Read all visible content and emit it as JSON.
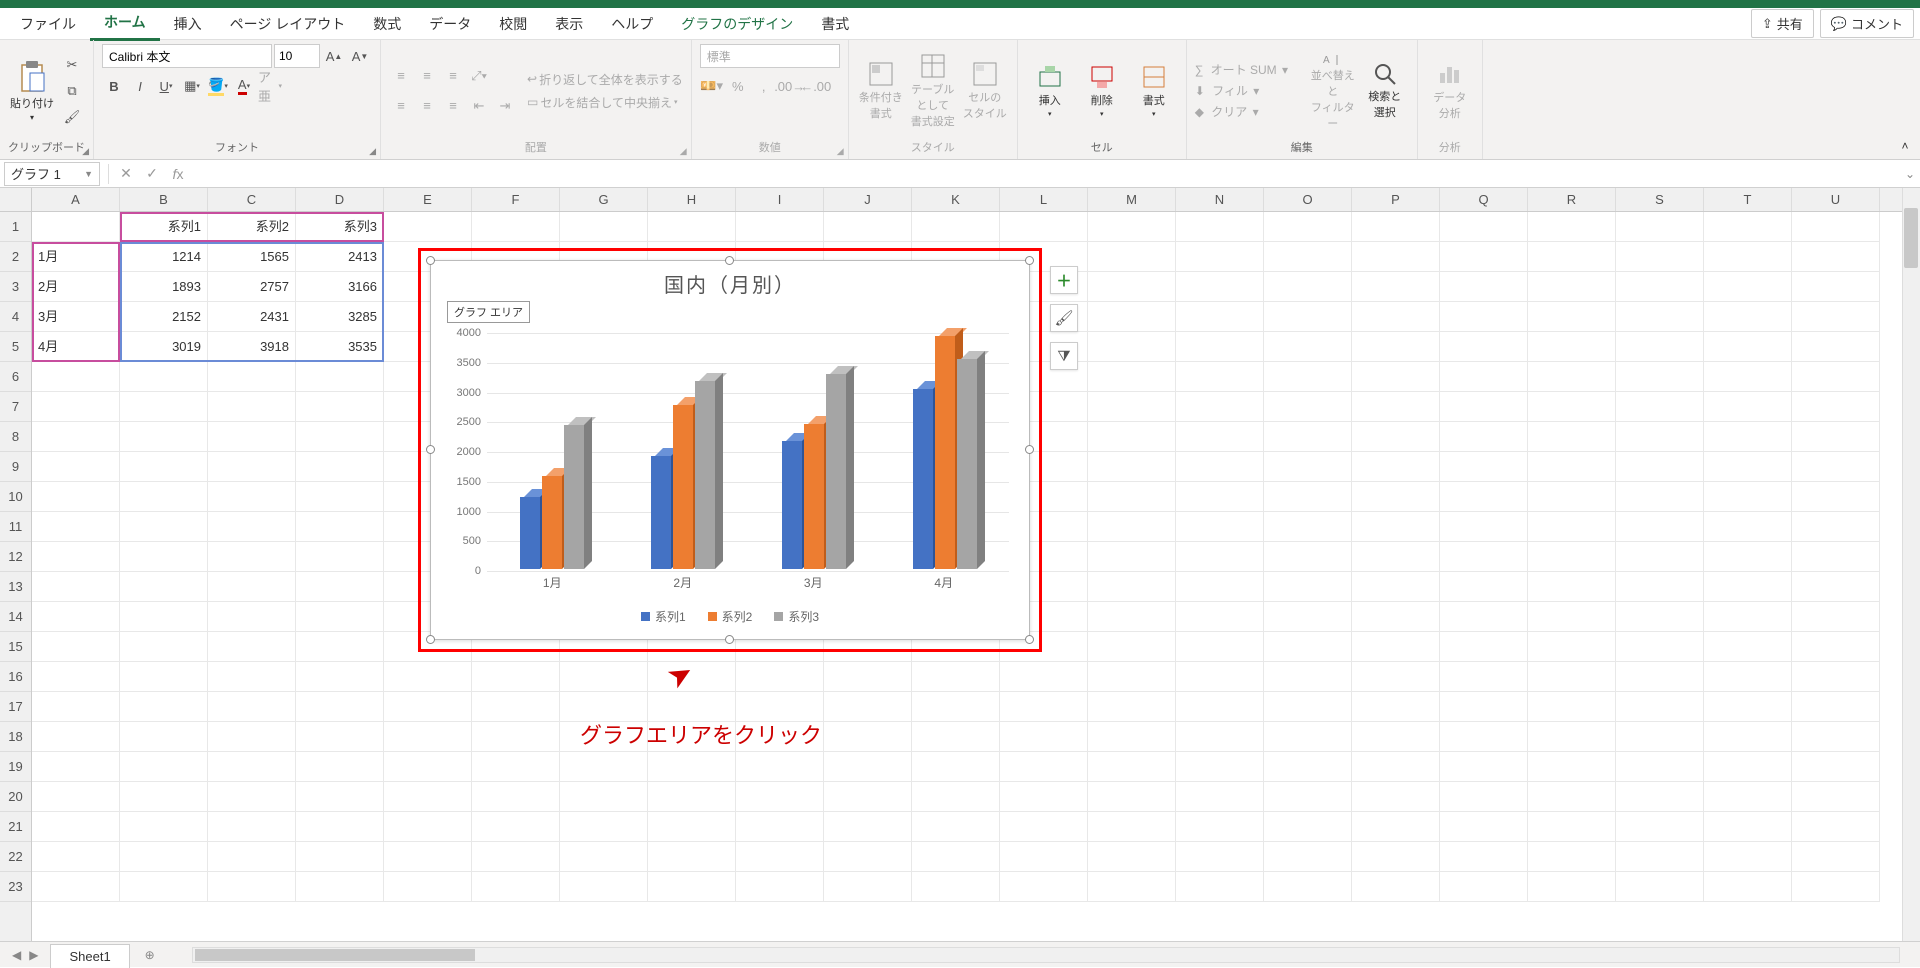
{
  "menu": {
    "tabs": [
      "ファイル",
      "ホーム",
      "挿入",
      "ページ レイアウト",
      "数式",
      "データ",
      "校閲",
      "表示",
      "ヘルプ",
      "グラフのデザイン",
      "書式"
    ],
    "active_index": 1,
    "share": "共有",
    "comment": "コメント"
  },
  "ribbon": {
    "clipboard": {
      "paste": "貼り付け",
      "group": "クリップボード"
    },
    "font": {
      "name": "Calibri 本文",
      "size": "10",
      "group": "フォント"
    },
    "alignment": {
      "wrap": "折り返して全体を表示する",
      "merge": "セルを結合して中央揃え",
      "group": "配置"
    },
    "number": {
      "format": "標準",
      "group": "数値"
    },
    "styles": {
      "cond": "条件付き\n書式",
      "table": "テーブルとして\n書式設定",
      "cell": "セルの\nスタイル",
      "group": "スタイル"
    },
    "cells": {
      "insert": "挿入",
      "delete": "削除",
      "format": "書式",
      "group": "セル"
    },
    "editing": {
      "autosum": "オート SUM",
      "fill": "フィル",
      "clear": "クリア",
      "sort": "並べ替えと\nフィルター",
      "find": "検索と\n選択",
      "group": "編集"
    },
    "analysis": {
      "label": "データ\n分析",
      "group": "分析"
    }
  },
  "namebox": "グラフ 1",
  "columns": [
    "A",
    "B",
    "C",
    "D",
    "E",
    "F",
    "G",
    "H",
    "I",
    "J",
    "K",
    "L",
    "M",
    "N",
    "O",
    "P",
    "Q",
    "R",
    "S",
    "T",
    "U"
  ],
  "rows": [
    "1",
    "2",
    "3",
    "4",
    "5",
    "6",
    "7",
    "8",
    "9",
    "10",
    "11",
    "12",
    "13",
    "14",
    "15",
    "16",
    "17",
    "18",
    "19",
    "20",
    "21",
    "22",
    "23"
  ],
  "table": {
    "headers": [
      "",
      "系列1",
      "系列2",
      "系列3"
    ],
    "rows": [
      [
        "1月",
        "1214",
        "1565",
        "2413"
      ],
      [
        "2月",
        "1893",
        "2757",
        "3166"
      ],
      [
        "3月",
        "2152",
        "2431",
        "3285"
      ],
      [
        "4月",
        "3019",
        "3918",
        "3535"
      ]
    ]
  },
  "chart_data": {
    "type": "bar",
    "title": "国内（月別）",
    "area_label": "グラフ エリア",
    "categories": [
      "1月",
      "2月",
      "3月",
      "4月"
    ],
    "series": [
      {
        "name": "系列1",
        "values": [
          1214,
          1893,
          2152,
          3019
        ],
        "color": "#4472c4"
      },
      {
        "name": "系列2",
        "values": [
          1565,
          2757,
          2431,
          3918
        ],
        "color": "#ed7d31"
      },
      {
        "name": "系列3",
        "values": [
          2413,
          3166,
          3285,
          3535
        ],
        "color": "#a5a5a5"
      }
    ],
    "ylim": [
      0,
      4000
    ],
    "yticks": [
      0,
      500,
      1000,
      1500,
      2000,
      2500,
      3000,
      3500,
      4000
    ]
  },
  "callout": "グラフエリアをクリック",
  "sheet": {
    "name": "Sheet1"
  }
}
